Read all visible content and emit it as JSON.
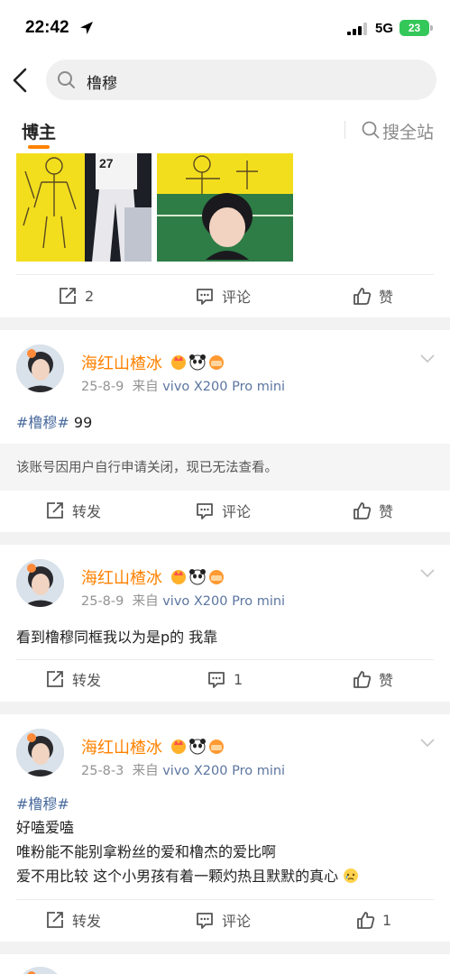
{
  "status_bar": {
    "time": "22:42",
    "network": "5G",
    "battery": "23"
  },
  "search": {
    "query": "橹穆"
  },
  "tabs": {
    "active": "博主",
    "search_all": "搜全站"
  },
  "posts": [
    {
      "actions": {
        "repost": "2",
        "comment": "评论",
        "like": "赞"
      }
    },
    {
      "username": "海红山楂冰",
      "date": "25-8-9",
      "source_prefix": "来自",
      "source": "vivo X200 Pro mini",
      "topic": "#橹穆#",
      "text": " 99",
      "repost_notice": "该账号因用户自行申请关闭，现已无法查看。",
      "actions": {
        "repost": "转发",
        "comment": "评论",
        "like": "赞"
      }
    },
    {
      "username": "海红山楂冰",
      "date": "25-8-9",
      "source_prefix": "来自",
      "source": "vivo X200 Pro mini",
      "text": "看到橹穆同框我以为是p的 我靠",
      "actions": {
        "repost": "转发",
        "comment": "1",
        "like": "赞"
      }
    },
    {
      "username": "海红山楂冰",
      "date": "25-8-3",
      "source_prefix": "来自",
      "source": "vivo X200 Pro mini",
      "topic": "#橹穆#",
      "lines": [
        "好嗑爱嗑",
        "唯粉能不能别拿粉丝的爱和橹杰的爱比啊",
        "爱不用比较 这个小男孩有着一颗灼热且默默的真心"
      ],
      "actions": {
        "repost": "转发",
        "comment": "评论",
        "like": "1"
      }
    }
  ],
  "colors": {
    "accent": "#ff8200",
    "topic": "#4a6b9e",
    "source": "#5b75a0",
    "background": "#f2f2f2"
  }
}
